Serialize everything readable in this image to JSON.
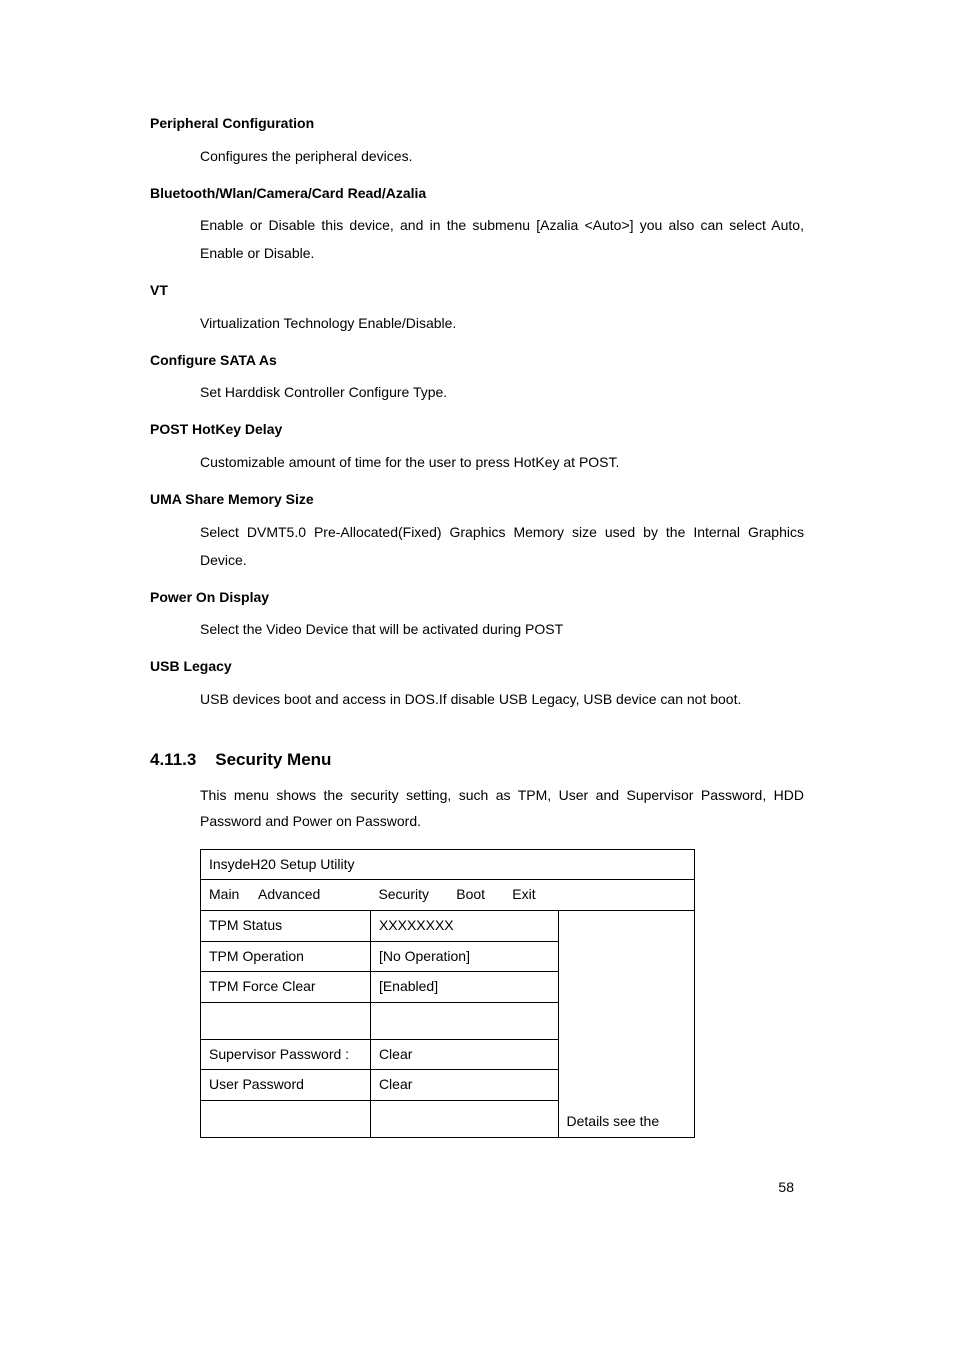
{
  "sections": {
    "periph_title": "Peripheral Configuration",
    "periph_body": "Configures the peripheral devices.",
    "bt_title": "Bluetooth/Wlan/Camera/Card Read/Azalia",
    "bt_body": "Enable or Disable this device, and in the submenu [Azalia <Auto>] you also can select Auto, Enable or Disable.",
    "vt_title": "VT",
    "vt_body": "Virtualization Technology Enable/Disable.",
    "sata_title": "Configure SATA As",
    "sata_body": "Set Harddisk Controller Configure Type.",
    "post_title": "POST HotKey Delay",
    "post_body": "Customizable amount of time for the user to press HotKey at POST.",
    "uma_title": "UMA Share Memory Size",
    "uma_body": "Select DVMT5.0 Pre-Allocated(Fixed) Graphics Memory size used by the Internal Graphics Device.",
    "pod_title": "Power On Display",
    "pod_body": "Select the Video Device that will be activated during POST",
    "usb_title": "USB Legacy",
    "usb_body": "USB devices boot and access in DOS.If disable USB Legacy, USB device can not boot."
  },
  "security": {
    "heading_num": "4.11.3",
    "heading_text": "Security Menu",
    "intro": "This menu shows the security setting, such as TPM, User and Supervisor Password, HDD Password and Power on Password."
  },
  "bios": {
    "header": "InsydeH20 Setup Utility",
    "tabs": {
      "main": "Main",
      "advanced": "Advanced",
      "security": "Security",
      "boot": "Boot",
      "exit": "Exit"
    },
    "rows": {
      "tpm_status_label": "TPM Status",
      "tpm_status_value": "XXXXXXXX",
      "tpm_op_label": "TPM Operation",
      "tpm_op_value": "[No Operation]",
      "tpm_clear_label": "TPM Force Clear",
      "tpm_clear_value": "[Enabled]",
      "sup_pw_label": "Supervisor Password :",
      "sup_pw_value": "Clear",
      "usr_pw_label": "User Password",
      "usr_pw_value": "Clear"
    },
    "side_text": "Details see the"
  },
  "page_number": "58"
}
